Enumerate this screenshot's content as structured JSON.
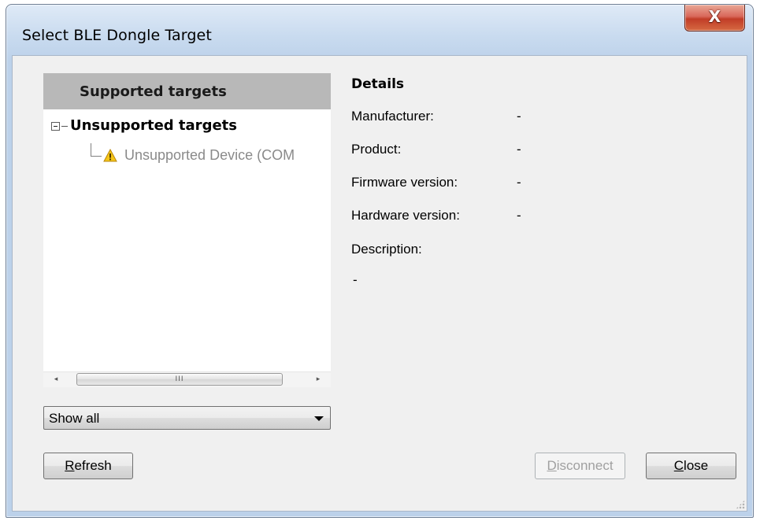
{
  "window": {
    "title": "Select BLE Dongle Target",
    "close_glyph": "X"
  },
  "tree": {
    "header": "Supported targets",
    "group": {
      "label": "Unsupported targets",
      "expanded": true,
      "children": [
        {
          "label": "Unsupported Device (COM",
          "icon": "warning-icon"
        }
      ]
    }
  },
  "scrollbar": {
    "left_arrow": "◂",
    "right_arrow": "▸",
    "grip": "III"
  },
  "filter": {
    "selected": "Show all"
  },
  "details": {
    "title": "Details",
    "fields": [
      {
        "label": "Manufacturer:",
        "value": "-"
      },
      {
        "label": "Product:",
        "value": "-"
      },
      {
        "label": "Firmware version:",
        "value": "-"
      },
      {
        "label": "Hardware version:",
        "value": "-"
      }
    ],
    "description_label": "Description:",
    "description_value": "-"
  },
  "buttons": {
    "refresh": "Refresh",
    "disconnect": "Disconnect",
    "close": "Close"
  },
  "colors": {
    "tree_header_bg": "#b8b8b8",
    "disabled_text": "#a0a0a0",
    "close_button_red": "#c13d27"
  }
}
